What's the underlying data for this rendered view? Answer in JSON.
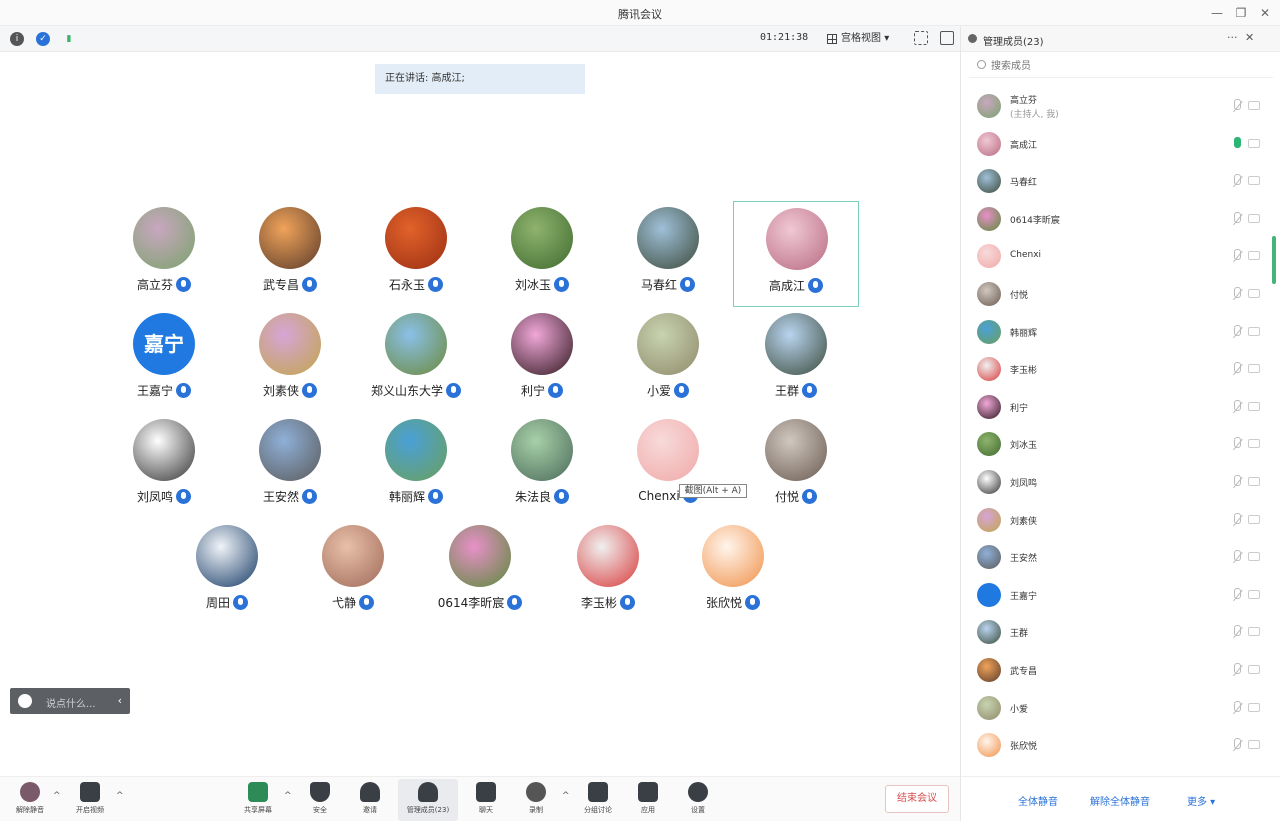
{
  "window": {
    "title": "腾讯会议"
  },
  "toolbar": {
    "timer": "01:21:38",
    "view_label": "宫格视图"
  },
  "banner": {
    "speaking": "正在讲话: 高成江;"
  },
  "grid": [
    {
      "name": "高立芬",
      "colors": [
        "#c9a7c0",
        "#7aa36b"
      ]
    },
    {
      "name": "武专昌",
      "colors": [
        "#f0a35a",
        "#5a3b2a"
      ]
    },
    {
      "name": "石永玉",
      "colors": [
        "#e2622a",
        "#9b2f14"
      ]
    },
    {
      "name": "刘冰玉",
      "colors": [
        "#8fb36e",
        "#3f6b2f"
      ]
    },
    {
      "name": "马春红",
      "colors": [
        "#9fc0d8",
        "#3c4a3a"
      ]
    },
    {
      "name": "高成江",
      "colors": [
        "#f0c8d4",
        "#b86b82"
      ],
      "active": true
    },
    {
      "name": "王嘉宁",
      "text": "嘉宁"
    },
    {
      "name": "刘素侠",
      "colors": [
        "#d7a5d8",
        "#c2a54a"
      ]
    },
    {
      "name": "郑义山东大学",
      "colors": [
        "#8ac0e8",
        "#6b8a3a"
      ]
    },
    {
      "name": "利宁",
      "colors": [
        "#f0a8d8",
        "#301820"
      ]
    },
    {
      "name": "小爱",
      "colors": [
        "#c8d3b0",
        "#8f8a6a"
      ]
    },
    {
      "name": "王群",
      "colors": [
        "#b9d4f0",
        "#3a4b3a"
      ]
    },
    {
      "name": "刘凤鸣",
      "colors": [
        "#ffffff",
        "#333333"
      ]
    },
    {
      "name": "王安然",
      "colors": [
        "#8fb0d8",
        "#5a5a5a"
      ]
    },
    {
      "name": "韩丽辉",
      "colors": [
        "#4aa0d8",
        "#6aa05a"
      ]
    },
    {
      "name": "朱法良",
      "colors": [
        "#a8d0a8",
        "#4a6a5a"
      ]
    },
    {
      "name": "Chenxi",
      "colors": [
        "#f8dada",
        "#f0a8a8"
      ]
    },
    {
      "name": "付悦",
      "colors": [
        "#d0c8c0",
        "#6a5a50"
      ]
    },
    {
      "name": "周田",
      "colors": [
        "#f0f4f8",
        "#163a66"
      ]
    },
    {
      "name": "弋静",
      "colors": [
        "#e8c0a8",
        "#a06a5a"
      ]
    },
    {
      "name": "0614李昕宸",
      "colors": [
        "#e890c8",
        "#5a8a3a"
      ]
    },
    {
      "name": "李玉彬",
      "colors": [
        "#f0f0f0",
        "#d83a3a"
      ]
    },
    {
      "name": "张欣悦",
      "colors": [
        "#fff5ec",
        "#f09048"
      ]
    }
  ],
  "tooltip": {
    "text": "截图(Alt + A)"
  },
  "chat": {
    "placeholder": "说点什么..."
  },
  "bottombar": {
    "mute": "解除静音",
    "video": "开启视频",
    "share": "共享屏幕",
    "security": "安全",
    "invite": "邀请",
    "manage": "管理成员(23)",
    "chat": "聊天",
    "record": "录制",
    "breakout": "分组讨论",
    "apps": "应用",
    "settings": "设置",
    "end": "结束会议"
  },
  "panel": {
    "title": "管理成员(23)",
    "search_placeholder": "搜索成员",
    "members": [
      {
        "name": "高立芬",
        "role": "(主持人, 我)",
        "colors": [
          "#c9a7c0",
          "#7aa36b"
        ]
      },
      {
        "name": "高成江",
        "speaking": true,
        "colors": [
          "#f0c8d4",
          "#b86b82"
        ]
      },
      {
        "name": "马春红",
        "colors": [
          "#9fc0d8",
          "#3c4a3a"
        ]
      },
      {
        "name": "0614李昕宸",
        "colors": [
          "#e890c8",
          "#5a8a3a"
        ]
      },
      {
        "name": "Chenxi",
        "colors": [
          "#f8dada",
          "#f0a8a8"
        ]
      },
      {
        "name": "付悦",
        "colors": [
          "#d0c8c0",
          "#6a5a50"
        ]
      },
      {
        "name": "韩丽辉",
        "colors": [
          "#4aa0d8",
          "#6aa05a"
        ]
      },
      {
        "name": "李玉彬",
        "colors": [
          "#f0f0f0",
          "#d83a3a"
        ]
      },
      {
        "name": "利宁",
        "colors": [
          "#f0a8d8",
          "#301820"
        ]
      },
      {
        "name": "刘冰玉",
        "colors": [
          "#8fb36e",
          "#3f6b2f"
        ]
      },
      {
        "name": "刘凤鸣",
        "colors": [
          "#ffffff",
          "#333333"
        ]
      },
      {
        "name": "刘素侠",
        "colors": [
          "#d7a5d8",
          "#c2a54a"
        ]
      },
      {
        "name": "王安然",
        "colors": [
          "#8fb0d8",
          "#5a5a5a"
        ]
      },
      {
        "name": "王嘉宁",
        "colors": [
          "#1f79e0",
          "#1f79e0"
        ]
      },
      {
        "name": "王群",
        "colors": [
          "#b9d4f0",
          "#3a4b3a"
        ]
      },
      {
        "name": "武专昌",
        "colors": [
          "#f0a35a",
          "#5a3b2a"
        ]
      },
      {
        "name": "小爱",
        "colors": [
          "#c8d3b0",
          "#8f8a6a"
        ]
      },
      {
        "name": "张欣悦",
        "colors": [
          "#fff5ec",
          "#f09048"
        ]
      }
    ],
    "footer": {
      "mute_all": "全体静音",
      "unmute_all": "解除全体静音",
      "more": "更多"
    }
  }
}
